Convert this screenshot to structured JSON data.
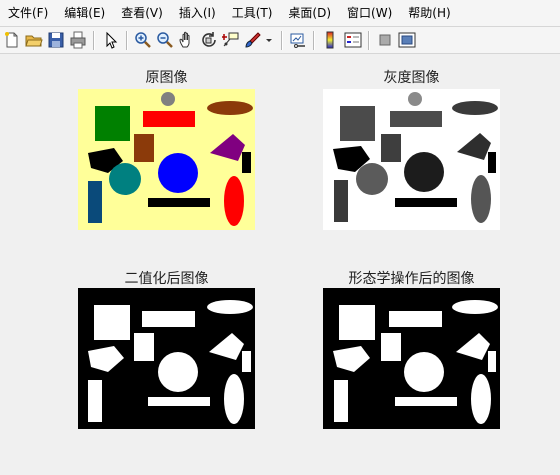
{
  "menu": {
    "items": [
      {
        "label": "文件(F)"
      },
      {
        "label": "编辑(E)"
      },
      {
        "label": "查看(V)"
      },
      {
        "label": "插入(I)"
      },
      {
        "label": "工具(T)"
      },
      {
        "label": "桌面(D)"
      },
      {
        "label": "窗口(W)"
      },
      {
        "label": "帮助(H)"
      }
    ]
  },
  "toolbar": {
    "icons": [
      "new-figure-icon",
      "open-file-icon",
      "save-icon",
      "print-icon",
      "pointer-icon",
      "zoom-in-icon",
      "zoom-out-icon",
      "pan-icon",
      "rotate-3d-icon",
      "data-cursor-icon",
      "brush-icon",
      "link-plot-icon",
      "colorbar-icon",
      "legend-icon",
      "hide-plot-tools-icon",
      "show-plot-tools-icon"
    ]
  },
  "plots": {
    "original": {
      "title": "原图像"
    },
    "gray": {
      "title": "灰度图像"
    },
    "binary": {
      "title": "二值化后图像"
    },
    "morph": {
      "title": "形态学操作后的图像"
    }
  },
  "colors": {
    "window_bg": "#f0f0f0",
    "canvas_bg_original": "#ffff99",
    "green": "#008000",
    "red": "#ff0000",
    "brown": "#8b3a0a",
    "purple": "#800080",
    "blue": "#0000ff",
    "teal": "#008080",
    "navy": "#0a4a7a",
    "gray_circle": "#808080",
    "black": "#000000",
    "white": "#ffffff"
  }
}
